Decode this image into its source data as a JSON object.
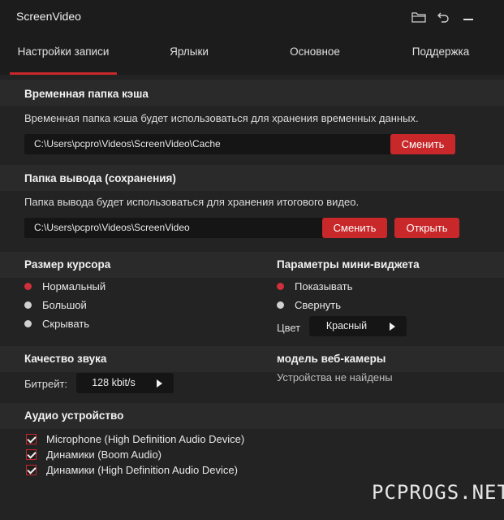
{
  "app": {
    "title": "ScreenVideo"
  },
  "titlebar": {
    "icons": [
      "folder-icon",
      "undo-icon",
      "minimize-icon"
    ]
  },
  "tabs": [
    {
      "label": "Настройки записи",
      "active": true
    },
    {
      "label": "Ярлыки",
      "active": false
    },
    {
      "label": "Основное",
      "active": false
    },
    {
      "label": "Поддержка",
      "active": false
    }
  ],
  "cache": {
    "heading": "Временная папка кэша",
    "description": "Временная папка кэша будет использоваться для хранения временных данных.",
    "path": "C:\\Users\\pcpro\\Videos\\ScreenVideo\\Cache",
    "change_label": "Сменить"
  },
  "output": {
    "heading": "Папка вывода (сохранения)",
    "description": "Папка вывода будет использоваться для хранения итогового видео.",
    "path": "C:\\Users\\pcpro\\Videos\\ScreenVideo",
    "change_label": "Сменить",
    "open_label": "Открыть"
  },
  "cursor": {
    "heading": "Размер курсора",
    "options": [
      {
        "label": "Нормальный",
        "selected": true
      },
      {
        "label": "Большой",
        "selected": false
      },
      {
        "label": "Скрывать",
        "selected": false
      }
    ]
  },
  "widget": {
    "heading": "Параметры мини-виджета",
    "options": [
      {
        "label": "Показывать",
        "selected": true
      },
      {
        "label": "Свернуть",
        "selected": false
      }
    ],
    "color_label": "Цвет",
    "color_value": "Красный"
  },
  "sound": {
    "heading": "Качество звука",
    "bitrate_label": "Битрейт:",
    "bitrate_value": "128 kbit/s"
  },
  "webcam": {
    "heading": "модель веб-камеры",
    "status": "Устройства не найдены"
  },
  "audio": {
    "heading": "Аудио устройство",
    "devices": [
      {
        "label": "Microphone (High Definition Audio Device)",
        "checked": true
      },
      {
        "label": "Динамики (Boom Audio)",
        "checked": true
      },
      {
        "label": "Динамики (High Definition Audio Device)",
        "checked": true
      }
    ]
  },
  "watermark": "PCPROGS.NET",
  "colors": {
    "accent": "#c8282a",
    "background": "#232323",
    "field": "#151515"
  }
}
